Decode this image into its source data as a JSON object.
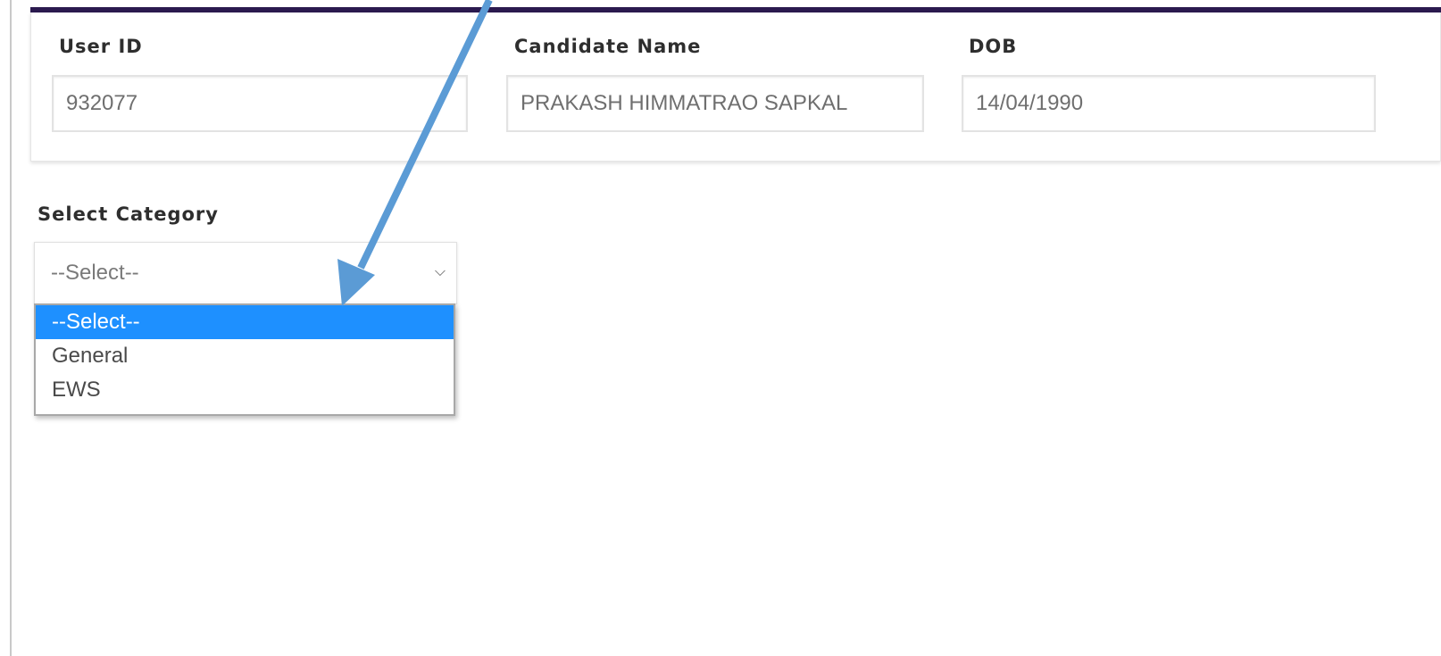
{
  "candidate_info": {
    "user_id": {
      "label": "User ID",
      "value": "932077"
    },
    "candidate_name": {
      "label": "Candidate Name",
      "value": "PRAKASH HIMMATRAO SAPKAL"
    },
    "dob": {
      "label": "DOB",
      "value": "14/04/1990"
    }
  },
  "category": {
    "label": "Select Category",
    "selected_value": "--Select--",
    "options": [
      "--Select--",
      "General",
      "EWS"
    ],
    "highlighted_option": "--Select--"
  },
  "colors": {
    "header_rule": "#2b1a4f",
    "option_highlight": "#1e90ff",
    "annotation_arrow": "#5b9bd5"
  },
  "icons": {
    "select_chevron": "chevron-down-icon",
    "annotation": "arrow-icon"
  }
}
